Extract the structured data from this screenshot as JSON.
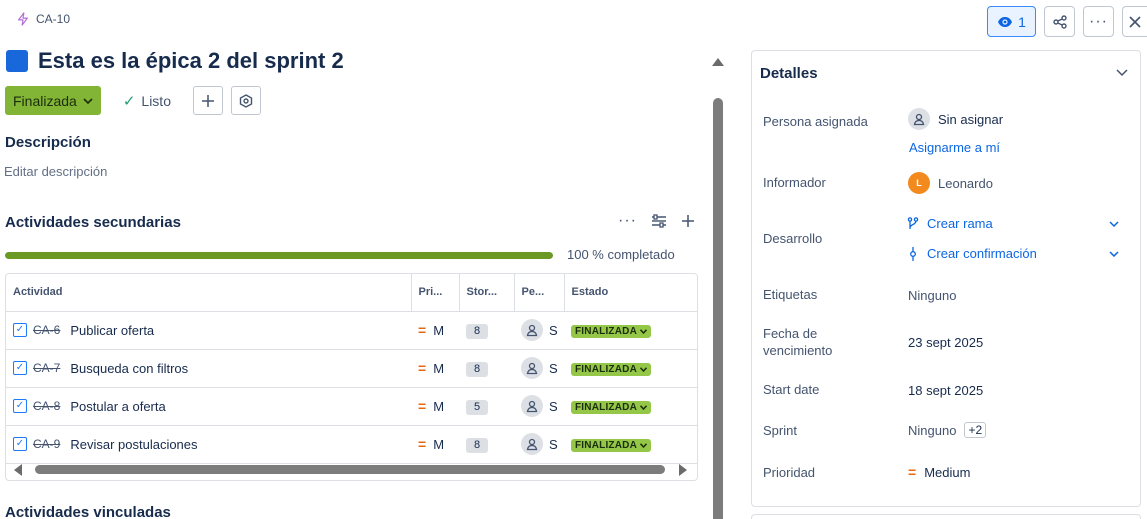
{
  "issue": {
    "key": "CA-10",
    "title": "Esta es la épica 2 del sprint 2",
    "status_label": "Finalizada",
    "resolution_label": "Listo"
  },
  "top_actions": {
    "watchers_count": "1"
  },
  "description": {
    "heading": "Descripción",
    "placeholder": "Editar descripción"
  },
  "child_work": {
    "heading": "Actividades secundarias",
    "progress_percent": 100,
    "progress_label": "100 % completado",
    "columns": [
      "Actividad",
      "Pri...",
      "Stor...",
      "Pe...",
      "Estado"
    ],
    "rows": [
      {
        "key": "CA-6",
        "summary": "Publicar oferta",
        "priority": "M",
        "story_points": "8",
        "assignee": "S",
        "status": "FINALIZADA"
      },
      {
        "key": "CA-7",
        "summary": "Busqueda con filtros",
        "priority": "M",
        "story_points": "8",
        "assignee": "S",
        "status": "FINALIZADA"
      },
      {
        "key": "CA-8",
        "summary": "Postular a oferta",
        "priority": "M",
        "story_points": "5",
        "assignee": "S",
        "status": "FINALIZADA"
      },
      {
        "key": "CA-9",
        "summary": "Revisar postulaciones",
        "priority": "M",
        "story_points": "8",
        "assignee": "S",
        "status": "FINALIZADA"
      }
    ]
  },
  "linked_work": {
    "heading": "Actividades vinculadas"
  },
  "details": {
    "heading": "Detalles",
    "assignee_label": "Persona asignada",
    "assignee_value": "Sin asignar",
    "assign_me": "Asignarme a mí",
    "reporter_label": "Informador",
    "reporter_initial": "L",
    "reporter_value": "Leonardo",
    "development_label": "Desarrollo",
    "create_branch": "Crear rama",
    "create_commit": "Crear confirmación",
    "labels_label": "Etiquetas",
    "labels_value": "Ninguno",
    "due_label": "Fecha de vencimiento",
    "due_value": "23 sept 2025",
    "start_label": "Start date",
    "start_value": "18 sept 2025",
    "sprint_label": "Sprint",
    "sprint_value": "Ninguno",
    "sprint_extra": "+2",
    "priority_label": "Prioridad",
    "priority_value": "Medium"
  },
  "colors": {
    "status_green": "#82b536",
    "lozenge_green": "#94c748",
    "progress_green": "#6a9a23",
    "link_blue": "#0c66e4",
    "epic_blue": "#1868db",
    "priority_orange": "#e56910",
    "reporter_avatar": "#f38a1d"
  }
}
